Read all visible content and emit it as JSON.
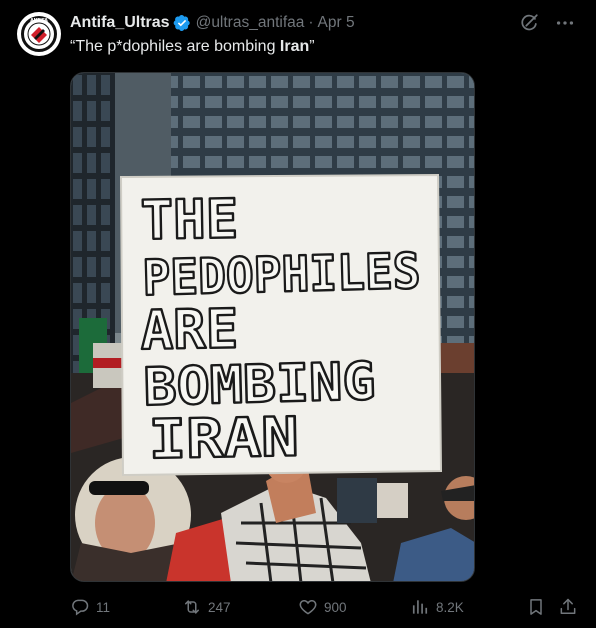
{
  "author": {
    "display_name": "Antifa_Ultras",
    "handle": "@ultras_antifaa",
    "separator": "·",
    "date": "Apr 5",
    "verified": true,
    "avatar_text": "ANTIFA"
  },
  "tweet": {
    "text_open": "“The p*dophiles are bombing ",
    "text_bold": "Iran",
    "text_close": "”"
  },
  "photo": {
    "sign_lines": [
      "THE",
      "PEDOPHILES",
      "ARE",
      "BOMBING",
      "IRAN"
    ]
  },
  "actions": {
    "replies": "11",
    "reposts": "247",
    "likes": "900",
    "views": "8.2K"
  },
  "colors": {
    "background": "#000000",
    "text_primary": "#e7e9ea",
    "text_secondary": "#71767b",
    "verified": "#1d9bf0"
  },
  "icons": [
    "grok-icon",
    "more-icon",
    "reply-icon",
    "repost-icon",
    "like-icon",
    "views-icon",
    "bookmark-icon",
    "share-icon",
    "verified-badge-icon"
  ]
}
